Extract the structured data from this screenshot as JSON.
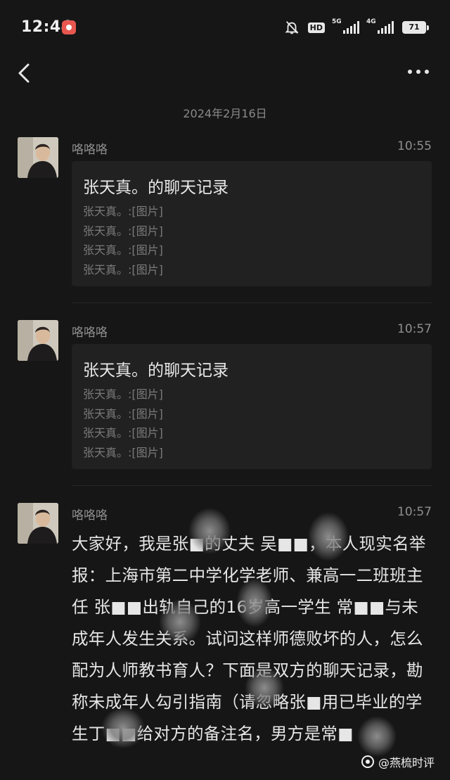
{
  "status_bar": {
    "time": "12:44",
    "hd_label": "HD",
    "signal_1_label": "5G",
    "signal_2_label": "4G",
    "battery": "71"
  },
  "chat": {
    "date_separator": "2024年2月16日",
    "messages": [
      {
        "sender": "咯咯咯",
        "time": "10:55",
        "card": {
          "title": "张天真。的聊天记录",
          "lines": [
            "张天真。:[图片]",
            "张天真。:[图片]",
            "张天真。:[图片]",
            "张天真。:[图片]"
          ]
        }
      },
      {
        "sender": "咯咯咯",
        "time": "10:57",
        "card": {
          "title": "张天真。的聊天记录",
          "lines": [
            "张天真。:[图片]",
            "张天真。:[图片]",
            "张天真。:[图片]",
            "张天真。:[图片]"
          ]
        }
      },
      {
        "sender": "咯咯咯",
        "time": "10:57",
        "text": "大家好，我是张■的丈夫 吴■■，本人现实名举报：上海市第二中学化学老师、兼高一二班班主任 张■■出轨自己的16岁高一学生 常■■与未成年人发生关系。试问这样师德败坏的人，怎么配为人师教书育人？下面是双方的聊天记录，勘称未成年人勾引指南（请忽略张■用已毕业的学生丁■■给对方的备注名，男方是常■"
      }
    ]
  },
  "watermark": {
    "text": "@燕梳时评",
    "icon": "watermark-logo-icon"
  }
}
